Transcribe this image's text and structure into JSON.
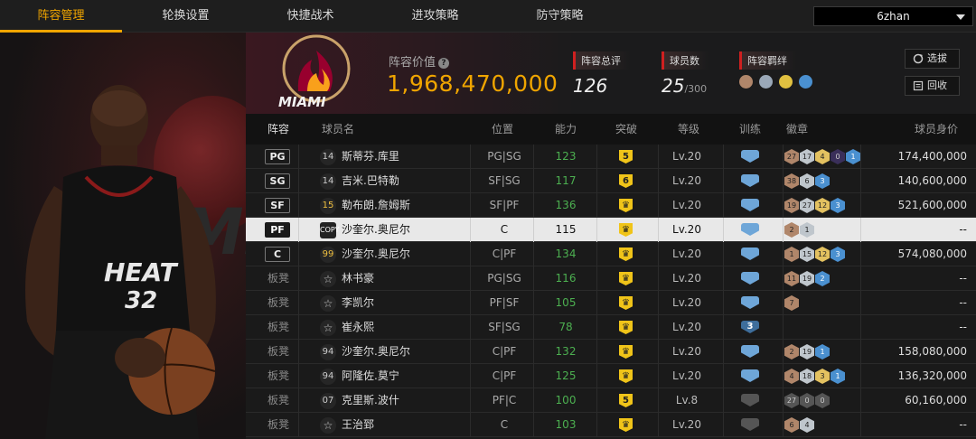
{
  "nav": {
    "tabs": [
      {
        "label": "阵容管理",
        "active": true
      },
      {
        "label": "轮换设置",
        "active": false
      },
      {
        "label": "快捷战术",
        "active": false
      },
      {
        "label": "进攻策略",
        "active": false
      },
      {
        "label": "防守策略",
        "active": false
      }
    ],
    "user": "6zhan"
  },
  "player_art": {
    "jersey_team": "HEAT",
    "jersey_number": "32"
  },
  "team": {
    "logo_text": "MIAMI",
    "lineup_value_label": "阵容价值",
    "lineup_value": "1,968,470,000",
    "overall_label": "阵容总评",
    "overall": "126",
    "players_label": "球员数",
    "players": "25",
    "players_max": "/300",
    "bond_label": "阵容羁绊",
    "bond_icons": [
      "person-icon",
      "team-icon",
      "group-gold-icon",
      "group-blue-icon"
    ],
    "btn_select": "选拔",
    "btn_recycle": "回收"
  },
  "table": {
    "headers": {
      "lineup": "阵容",
      "name": "球员名",
      "position": "位置",
      "ability": "能力",
      "breakthrough": "突破",
      "level": "等级",
      "training": "训练",
      "badges": "徽章",
      "value": "球员身价"
    },
    "rows": [
      {
        "slot": "PG",
        "bench": false,
        "num": "14",
        "numStyle": "plain",
        "name": "斯蒂芬.库里",
        "pos": "PG|SG",
        "ability": "123",
        "brk": "5",
        "level": "Lv.20",
        "train": "",
        "badges": [
          [
            "27",
            "bronze"
          ],
          [
            "17",
            "silver"
          ],
          [
            "4",
            "gold"
          ],
          [
            "0",
            "purple"
          ],
          [
            "1",
            "blue"
          ]
        ],
        "value": "174,400,000",
        "selected": false
      },
      {
        "slot": "SG",
        "bench": false,
        "num": "14",
        "numStyle": "plain",
        "name": "吉米.巴特勒",
        "pos": "SF|SG",
        "ability": "117",
        "brk": "6",
        "level": "Lv.20",
        "train": "",
        "badges": [
          [
            "38",
            "bronze"
          ],
          [
            "6",
            "silver"
          ],
          [
            "3",
            "blue"
          ]
        ],
        "value": "140,600,000",
        "selected": false
      },
      {
        "slot": "SF",
        "bench": false,
        "num": "15",
        "numStyle": "gold",
        "name": "勒布朗.詹姆斯",
        "pos": "SF|PF",
        "ability": "136",
        "brk": "",
        "level": "Lv.20",
        "train": "",
        "badges": [
          [
            "19",
            "bronze"
          ],
          [
            "27",
            "silver"
          ],
          [
            "12",
            "gold"
          ],
          [
            "3",
            "blue"
          ]
        ],
        "value": "521,600,000",
        "selected": false
      },
      {
        "slot": "PF",
        "bench": false,
        "num": "COPY",
        "numStyle": "dark",
        "name": "沙奎尔.奥尼尔",
        "pos": "C",
        "ability": "115",
        "brk": "",
        "level": "Lv.20",
        "train": "",
        "badges": [
          [
            "2",
            "bronze"
          ],
          [
            "1",
            "silver"
          ]
        ],
        "value": "--",
        "selected": true
      },
      {
        "slot": "C",
        "bench": false,
        "num": "99",
        "numStyle": "gold",
        "name": "沙奎尔.奥尼尔",
        "pos": "C|PF",
        "ability": "134",
        "brk": "",
        "level": "Lv.20",
        "train": "",
        "badges": [
          [
            "1",
            "bronze"
          ],
          [
            "15",
            "silver"
          ],
          [
            "12",
            "gold"
          ],
          [
            "3",
            "blue"
          ]
        ],
        "value": "574,080,000",
        "selected": false
      },
      {
        "slot": "板凳",
        "bench": true,
        "num": "☆",
        "numStyle": "star",
        "name": "林书豪",
        "pos": "PG|SG",
        "ability": "116",
        "brk": "",
        "level": "Lv.20",
        "train": "",
        "badges": [
          [
            "11",
            "bronze"
          ],
          [
            "19",
            "silver"
          ],
          [
            "2",
            "blue"
          ]
        ],
        "value": "--",
        "selected": false
      },
      {
        "slot": "板凳",
        "bench": true,
        "num": "☆",
        "numStyle": "star",
        "name": "李凯尔",
        "pos": "PF|SF",
        "ability": "105",
        "brk": "",
        "level": "Lv.20",
        "train": "",
        "badges": [
          [
            "7",
            "bronze"
          ]
        ],
        "value": "--",
        "selected": false
      },
      {
        "slot": "板凳",
        "bench": true,
        "num": "☆",
        "numStyle": "star",
        "name": "崔永熙",
        "pos": "SF|SG",
        "ability": "78",
        "brk": "",
        "level": "Lv.20",
        "train": "3",
        "badges": [],
        "value": "--",
        "selected": false
      },
      {
        "slot": "板凳",
        "bench": true,
        "num": "94",
        "numStyle": "plain",
        "name": "沙奎尔.奥尼尔",
        "pos": "C|PF",
        "ability": "132",
        "brk": "",
        "level": "Lv.20",
        "train": "",
        "badges": [
          [
            "2",
            "bronze"
          ],
          [
            "19",
            "silver"
          ],
          [
            "1",
            "blue"
          ]
        ],
        "value": "158,080,000",
        "selected": false
      },
      {
        "slot": "板凳",
        "bench": true,
        "num": "94",
        "numStyle": "plain",
        "name": "阿隆佐.莫宁",
        "pos": "C|PF",
        "ability": "125",
        "brk": "",
        "level": "Lv.20",
        "train": "",
        "badges": [
          [
            "4",
            "bronze"
          ],
          [
            "18",
            "silver"
          ],
          [
            "3",
            "gold"
          ],
          [
            "1",
            "blue"
          ]
        ],
        "value": "136,320,000",
        "selected": false
      },
      {
        "slot": "板凳",
        "bench": true,
        "num": "07",
        "numStyle": "plain",
        "name": "克里斯.波什",
        "pos": "PF|C",
        "ability": "100",
        "brk": "5",
        "level": "Lv.8",
        "train": "grey",
        "badges": [
          [
            "27",
            "grey"
          ],
          [
            "0",
            "grey"
          ],
          [
            "0",
            "grey"
          ]
        ],
        "value": "60,160,000",
        "selected": false
      },
      {
        "slot": "板凳",
        "bench": true,
        "num": "☆",
        "numStyle": "star",
        "name": "王治郅",
        "pos": "C",
        "ability": "103",
        "brk": "",
        "level": "Lv.20",
        "train": "grey",
        "badges": [
          [
            "6",
            "bronze"
          ],
          [
            "4",
            "silver"
          ]
        ],
        "value": "--",
        "selected": false
      }
    ]
  },
  "colors": {
    "accent": "#f0a500",
    "ability_green": "#4caf50",
    "heat_red": "#98002e"
  }
}
